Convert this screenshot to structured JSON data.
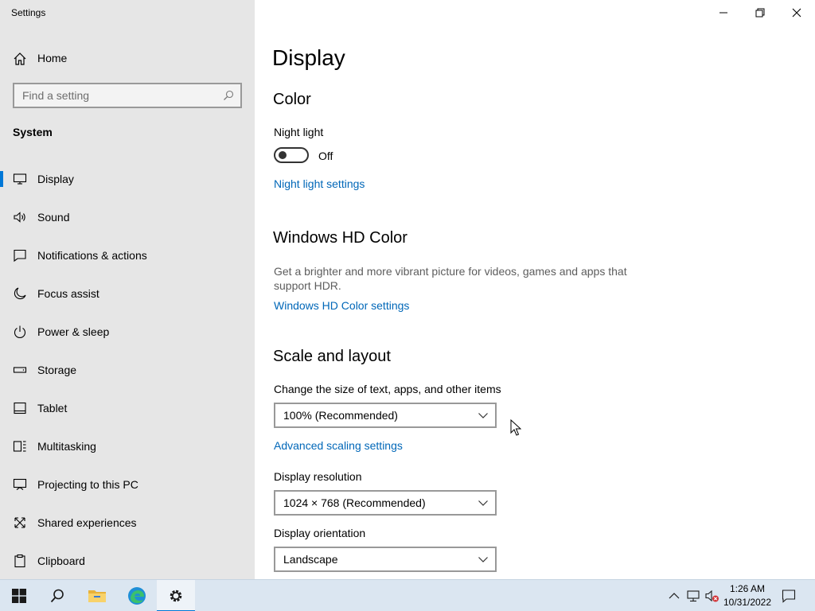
{
  "window": {
    "title": "Settings",
    "controls": [
      "minimize-icon",
      "restore-icon",
      "close-icon"
    ]
  },
  "sidebar": {
    "home_label": "Home",
    "search_placeholder": "Find a setting",
    "section_title": "System",
    "items": [
      {
        "label": "Display",
        "icon": "monitor-icon",
        "selected": true
      },
      {
        "label": "Sound",
        "icon": "speaker-icon"
      },
      {
        "label": "Notifications & actions",
        "icon": "notification-icon"
      },
      {
        "label": "Focus assist",
        "icon": "moon-icon"
      },
      {
        "label": "Power & sleep",
        "icon": "power-icon"
      },
      {
        "label": "Storage",
        "icon": "storage-icon"
      },
      {
        "label": "Tablet",
        "icon": "tablet-icon"
      },
      {
        "label": "Multitasking",
        "icon": "multitasking-icon"
      },
      {
        "label": "Projecting to this PC",
        "icon": "projecting-icon"
      },
      {
        "label": "Shared experiences",
        "icon": "shared-icon"
      },
      {
        "label": "Clipboard",
        "icon": "clipboard-icon"
      }
    ]
  },
  "main": {
    "page_title": "Display",
    "color": {
      "heading": "Color",
      "night_light_label": "Night light",
      "night_light_state": "Off",
      "night_light_link": "Night light settings"
    },
    "hd_color": {
      "heading": "Windows HD Color",
      "description": "Get a brighter and more vibrant picture for videos, games and apps that support HDR.",
      "link": "Windows HD Color settings"
    },
    "scale_layout": {
      "heading": "Scale and layout",
      "scale_label": "Change the size of text, apps, and other items",
      "scale_value": "100% (Recommended)",
      "advanced_link": "Advanced scaling settings",
      "resolution_label": "Display resolution",
      "resolution_value": "1024 × 768 (Recommended)",
      "orientation_label": "Display orientation",
      "orientation_value": "Landscape"
    }
  },
  "taskbar": {
    "time": "1:26 AM",
    "date": "10/31/2022",
    "apps": [
      "windows-start-icon",
      "search-icon",
      "file-explorer-icon",
      "edge-icon",
      "settings-gear-icon"
    ]
  },
  "colors": {
    "accent": "#0078d7",
    "link": "#0067b8",
    "sidebar_bg": "#e6e6e6",
    "taskbar_bg": "#dbe6f1"
  }
}
